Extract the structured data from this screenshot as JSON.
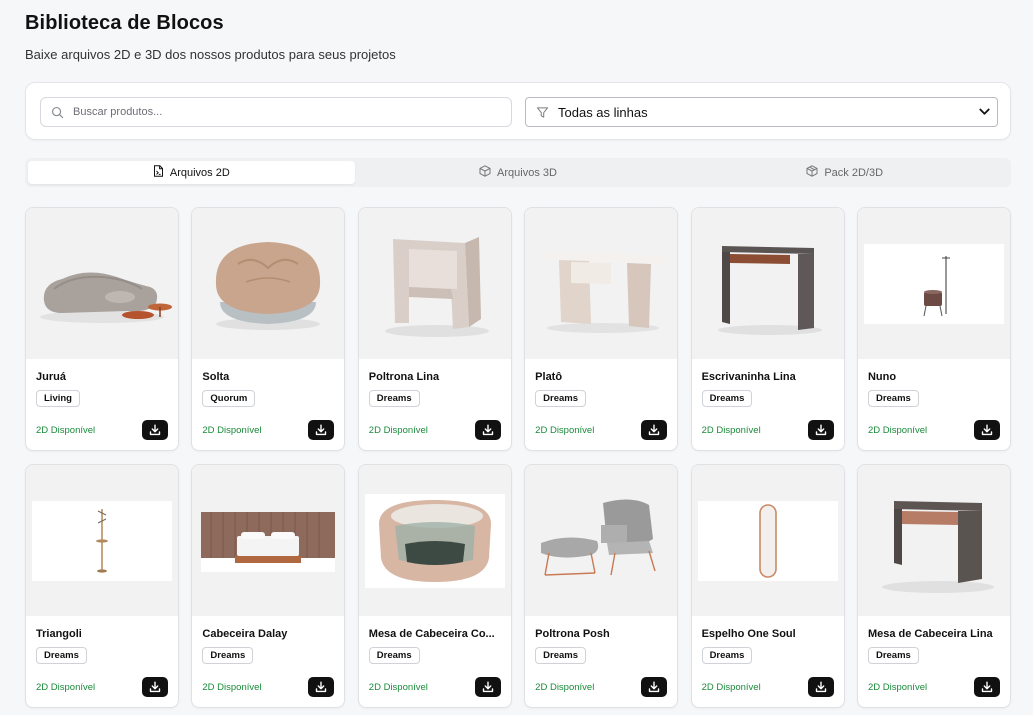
{
  "header": {
    "title": "Biblioteca de Blocos",
    "subtitle": "Baixe arquivos 2D e 3D dos nossos produtos para seus projetos"
  },
  "filters": {
    "search_placeholder": "Buscar produtos...",
    "search_value": "",
    "line_select_value": "Todas as linhas"
  },
  "tabs": [
    {
      "label": "Arquivos 2D",
      "icon": "file-2d-icon",
      "active": true
    },
    {
      "label": "Arquivos 3D",
      "icon": "cube-icon",
      "active": false
    },
    {
      "label": "Pack 2D/3D",
      "icon": "package-icon",
      "active": false
    }
  ],
  "products": [
    {
      "name": "Juruá",
      "line": "Living",
      "status": "2D Disponível",
      "image": "sofa"
    },
    {
      "name": "Solta",
      "line": "Quorum",
      "status": "2D Disponível",
      "image": "beanbag"
    },
    {
      "name": "Poltrona Lina",
      "line": "Dreams",
      "status": "2D Disponível",
      "image": "armchair"
    },
    {
      "name": "Platô",
      "line": "Dreams",
      "status": "2D Disponível",
      "image": "desk-light"
    },
    {
      "name": "Escrivaninha Lina",
      "line": "Dreams",
      "status": "2D Disponível",
      "image": "desk-dark"
    },
    {
      "name": "Nuno",
      "line": "Dreams",
      "status": "2D Disponível",
      "image": "valet-stand"
    },
    {
      "name": "Triangoli",
      "line": "Dreams",
      "status": "2D Disponível",
      "image": "coat-rack"
    },
    {
      "name": "Cabeceira Dalay",
      "line": "Dreams",
      "status": "2D Disponível",
      "image": "bed-headboard"
    },
    {
      "name": "Mesa de Cabeceira Co...",
      "line": "Dreams",
      "status": "2D Disponível",
      "image": "oval-nightstand"
    },
    {
      "name": "Poltrona Posh",
      "line": "Dreams",
      "status": "2D Disponível",
      "image": "lounge-chair"
    },
    {
      "name": "Espelho One Soul",
      "line": "Dreams",
      "status": "2D Disponível",
      "image": "mirror"
    },
    {
      "name": "Mesa de Cabeceira Lina",
      "line": "Dreams",
      "status": "2D Disponível",
      "image": "nightstand-dark"
    }
  ],
  "colors": {
    "available": "#1a8a3a",
    "download_button": "#111111",
    "background": "#f6f7f8"
  }
}
